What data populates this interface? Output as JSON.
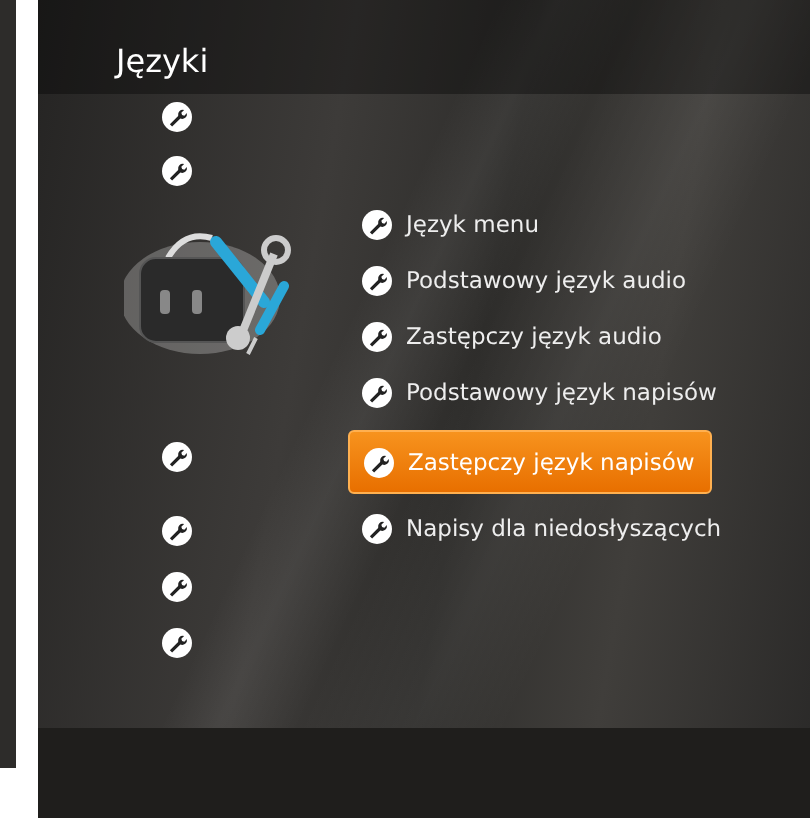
{
  "screen": {
    "title": "Języki"
  },
  "menu": [
    {
      "label": "Język menu",
      "selected": false
    },
    {
      "label": "Podstawowy język audio",
      "selected": false
    },
    {
      "label": "Zastępczy język audio",
      "selected": false
    },
    {
      "label": "Podstawowy język napisów",
      "selected": false
    },
    {
      "label": "Zastępczy język napisów",
      "selected": true
    },
    {
      "label": "Napisy dla niedosłyszących",
      "selected": false
    }
  ]
}
